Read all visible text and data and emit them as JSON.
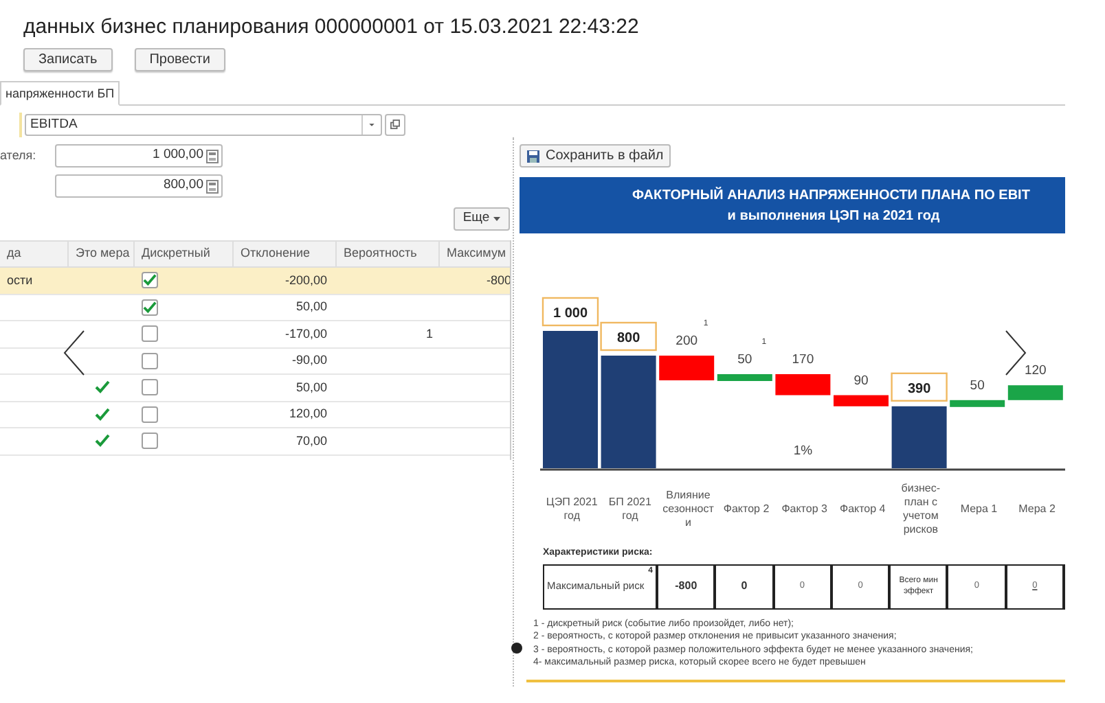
{
  "window": {
    "title": "данных бизнес планирования 000000001 от 15.03.2021 22:43:22"
  },
  "toolbar": {
    "buttons": [
      "Записать",
      "Провести"
    ]
  },
  "tabs": [
    {
      "label": "напряженности БП",
      "selected": true
    }
  ],
  "indicator_field": {
    "value": "EBITDA"
  },
  "fields": [
    {
      "label": "ателя:",
      "value": "1 000,00"
    },
    {
      "value": "800,00"
    }
  ],
  "more_button": "Еще",
  "table": {
    "columns": [
      "да",
      "Это мера",
      "Дискретный",
      "Отклонение",
      "Вероятность",
      "Максимум"
    ],
    "rows": [
      {
        "selected": true,
        "name": "ости",
        "measure": false,
        "discrete": true,
        "deviation": "-200,00",
        "probability": "",
        "maximum": "-800"
      },
      {
        "selected": false,
        "name": "",
        "measure": false,
        "discrete": true,
        "deviation": "50,00",
        "probability": "",
        "maximum": ""
      },
      {
        "selected": false,
        "name": "",
        "measure": false,
        "discrete": false,
        "deviation": "-170,00",
        "probability": "1",
        "maximum": ""
      },
      {
        "selected": false,
        "name": "",
        "measure": false,
        "discrete": false,
        "deviation": "-90,00",
        "probability": "",
        "maximum": ""
      },
      {
        "selected": false,
        "name": "",
        "measure": true,
        "discrete": false,
        "deviation": "50,00",
        "probability": "",
        "maximum": ""
      },
      {
        "selected": false,
        "name": "",
        "measure": true,
        "discrete": false,
        "deviation": "120,00",
        "probability": "",
        "maximum": ""
      },
      {
        "selected": false,
        "name": "",
        "measure": true,
        "discrete": false,
        "deviation": "70,00",
        "probability": "",
        "maximum": ""
      }
    ]
  },
  "report": {
    "save_button": "Сохранить в файл",
    "title": "ФАКТОРНЫЙ АНАЛИЗ НАПРЯЖЕННОСТИ ПЛАНА ПО EBIT",
    "subtitle": "и выполнения ЦЭП на 2021 год",
    "waterfall": [
      {
        "label": "ЦЭП 2021 год",
        "value_label": "1 000",
        "kind": "total"
      },
      {
        "label": "БП 2021 год",
        "value_label": "800",
        "kind": "total"
      },
      {
        "label": "Влияние сезонности",
        "value_label": "200",
        "kind": "decrease",
        "footnote_mark": "1"
      },
      {
        "label": "Фактор 2",
        "value_label": "50",
        "kind": "increase",
        "footnote_mark": "1"
      },
      {
        "label": "Фактор 3",
        "value_label": "170",
        "kind": "decrease",
        "note": "1%"
      },
      {
        "label": "Фактор 4",
        "value_label": "90",
        "kind": "decrease"
      },
      {
        "label": "бизнес-план с учетом рисков",
        "value_label": "390",
        "kind": "total"
      },
      {
        "label": "Мера 1",
        "value_label": "50",
        "kind": "increase"
      },
      {
        "label": "Мера 2",
        "value_label": "120",
        "kind": "increase"
      }
    ],
    "risk_heading": "Характеристики риска:",
    "risk_row": {
      "label": "Максимальный риск",
      "mark": "4",
      "cells": [
        "-800",
        "0",
        "0",
        "0",
        "Всего мин эффект",
        "0",
        "0"
      ]
    },
    "notes": [
      "1 - дискретный риск (событие либо произойдет, либо нет);",
      "2 - вероятность, с которой размер отклонения не привысит указанного значения;",
      "3 - вероятность, с которой размер положительного эффекта будет не менее указанного значения;",
      "4- максимальный размер риска, который скорее всего не будет превышен"
    ]
  }
}
